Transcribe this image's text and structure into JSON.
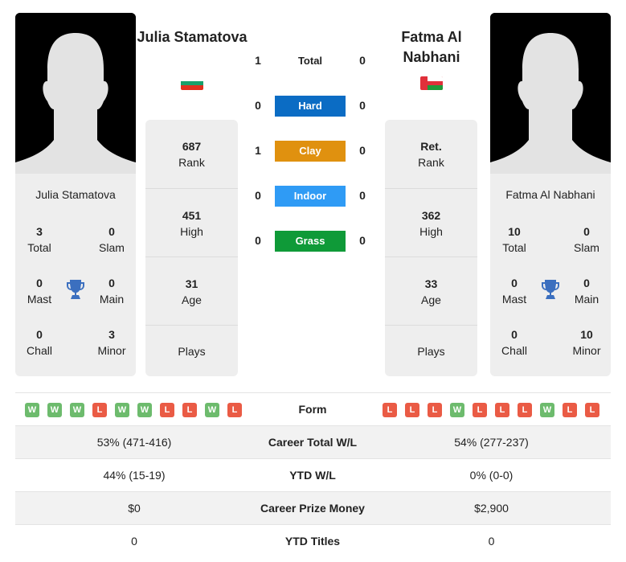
{
  "colors": {
    "hard": "#0b6cc4",
    "clay": "#e0910f",
    "indoor": "#2f9bf5",
    "grass": "#0f9a38",
    "win": "#6dbb6d",
    "loss": "#ea5b45",
    "trophy": "#3b6fbf"
  },
  "player_left": {
    "name": "Julia Stamatova",
    "flag": "bulgaria-flag",
    "titles": {
      "total": {
        "value": "3",
        "label": "Total"
      },
      "slam": {
        "value": "0",
        "label": "Slam"
      },
      "mast": {
        "value": "0",
        "label": "Mast"
      },
      "main": {
        "value": "0",
        "label": "Main"
      },
      "chall": {
        "value": "0",
        "label": "Chall"
      },
      "minor": {
        "value": "3",
        "label": "Minor"
      }
    },
    "stats": {
      "rank": {
        "value": "687",
        "label": "Rank"
      },
      "high": {
        "value": "451",
        "label": "High"
      },
      "age": {
        "value": "31",
        "label": "Age"
      },
      "plays": {
        "value": "",
        "label": "Plays"
      }
    },
    "form": [
      "W",
      "W",
      "W",
      "L",
      "W",
      "W",
      "L",
      "L",
      "W",
      "L"
    ]
  },
  "player_right": {
    "name": "Fatma Al Nabhani",
    "flag": "oman-flag",
    "titles": {
      "total": {
        "value": "10",
        "label": "Total"
      },
      "slam": {
        "value": "0",
        "label": "Slam"
      },
      "mast": {
        "value": "0",
        "label": "Mast"
      },
      "main": {
        "value": "0",
        "label": "Main"
      },
      "chall": {
        "value": "0",
        "label": "Chall"
      },
      "minor": {
        "value": "10",
        "label": "Minor"
      }
    },
    "stats": {
      "rank": {
        "value": "Ret.",
        "label": "Rank"
      },
      "high": {
        "value": "362",
        "label": "High"
      },
      "age": {
        "value": "33",
        "label": "Age"
      },
      "plays": {
        "value": "",
        "label": "Plays"
      }
    },
    "form": [
      "L",
      "L",
      "L",
      "W",
      "L",
      "L",
      "L",
      "W",
      "L",
      "L"
    ]
  },
  "h2h": [
    {
      "label": "Total",
      "left": "1",
      "right": "0"
    },
    {
      "label": "Hard",
      "left": "0",
      "right": "0"
    },
    {
      "label": "Clay",
      "left": "1",
      "right": "0"
    },
    {
      "label": "Indoor",
      "left": "0",
      "right": "0"
    },
    {
      "label": "Grass",
      "left": "0",
      "right": "0"
    }
  ],
  "comparison": [
    {
      "label": "Form",
      "left": "",
      "right": ""
    },
    {
      "label": "Career Total W/L",
      "left": "53% (471-416)",
      "right": "54% (277-237)"
    },
    {
      "label": "YTD W/L",
      "left": "44% (15-19)",
      "right": "0% (0-0)"
    },
    {
      "label": "Career Prize Money",
      "left": "$0",
      "right": "$2,900"
    },
    {
      "label": "YTD Titles",
      "left": "0",
      "right": "0"
    }
  ]
}
